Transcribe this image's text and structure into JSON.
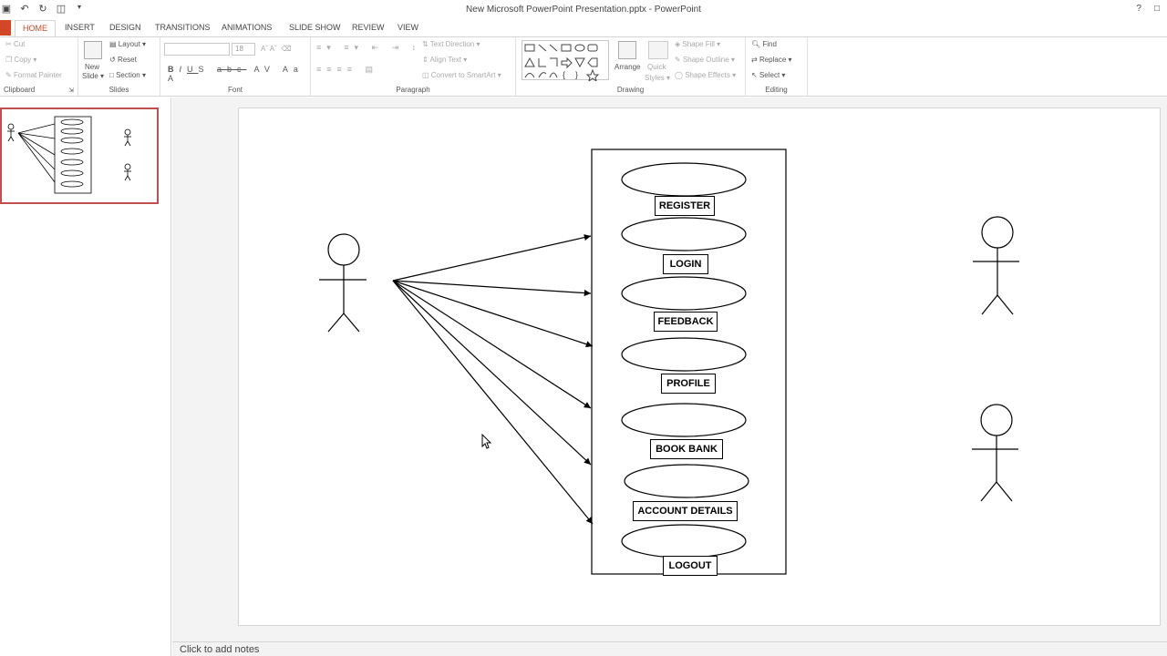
{
  "window": {
    "title": "New Microsoft PowerPoint Presentation.pptx - PowerPoint",
    "help": "?"
  },
  "tabs": [
    "HOME",
    "INSERT",
    "DESIGN",
    "TRANSITIONS",
    "ANIMATIONS",
    "SLIDE SHOW",
    "REVIEW",
    "VIEW"
  ],
  "active_tab": "HOME",
  "ribbon": {
    "clipboard": {
      "label": "Clipboard",
      "cut": "Cut",
      "copy": "Copy",
      "format_painter": "Format Painter"
    },
    "slides": {
      "label": "Slides",
      "new_slide_1": "New",
      "new_slide_2": "Slide",
      "layout": "Layout",
      "reset": "Reset",
      "section": "Section"
    },
    "font": {
      "label": "Font",
      "size": "18"
    },
    "paragraph": {
      "label": "Paragraph",
      "text_direction": "Text Direction",
      "align_text": "Align Text",
      "convert": "Convert to SmartArt"
    },
    "drawing": {
      "label": "Drawing",
      "arrange": "Arrange",
      "quick_1": "Quick",
      "quick_2": "Styles",
      "shape_fill": "Shape Fill",
      "shape_outline": "Shape Outline",
      "shape_effects": "Shape Effects"
    },
    "editing": {
      "label": "Editing",
      "find": "Find",
      "replace": "Replace",
      "select": "Select"
    }
  },
  "slide": {
    "use_cases": [
      "REGISTER",
      "LOGIN",
      "FEEDBACK",
      "PROFILE",
      "BOOK BANK",
      "ACCOUNT DETAILS",
      "LOGOUT"
    ]
  },
  "notes_placeholder": "Click to add notes",
  "colors": {
    "accent": "#d24726",
    "thumb_border": "#c0504d"
  }
}
